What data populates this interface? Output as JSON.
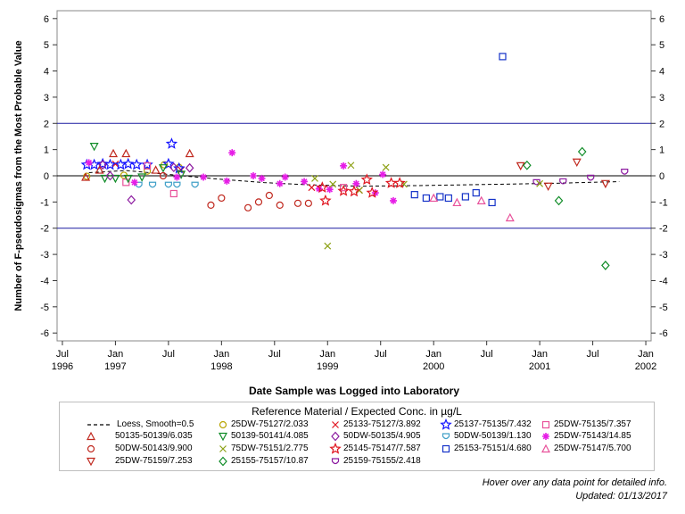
{
  "chart_data": {
    "type": "scatter",
    "xlabel": "Date Sample was Logged into Laboratory",
    "ylabel": "Number of F-pseudosigmas from the Most Probable Value",
    "xlim": [
      1996.45,
      2002.05
    ],
    "ylim": [
      -6.3,
      6.3
    ],
    "x_ticks": [
      {
        "x": 1996.5,
        "label": "Jul",
        "sub": "1996"
      },
      {
        "x": 1997.0,
        "label": "Jan",
        "sub": "1997"
      },
      {
        "x": 1997.5,
        "label": "Jul",
        "sub": ""
      },
      {
        "x": 1998.0,
        "label": "Jan",
        "sub": "1998"
      },
      {
        "x": 1998.5,
        "label": "Jul",
        "sub": ""
      },
      {
        "x": 1999.0,
        "label": "Jan",
        "sub": "1999"
      },
      {
        "x": 1999.5,
        "label": "Jul",
        "sub": ""
      },
      {
        "x": 2000.0,
        "label": "Jan",
        "sub": "2000"
      },
      {
        "x": 2000.5,
        "label": "Jul",
        "sub": ""
      },
      {
        "x": 2001.0,
        "label": "Jan",
        "sub": "2001"
      },
      {
        "x": 2001.5,
        "label": "Jul",
        "sub": ""
      },
      {
        "x": 2002.0,
        "label": "Jan",
        "sub": "2002"
      }
    ],
    "y_ticks": [
      6,
      5,
      4,
      3,
      2,
      1,
      0,
      -1,
      -2,
      -3,
      -4,
      -5,
      -6
    ],
    "reference_lines": {
      "solid_black": [
        0
      ],
      "solid_blue": [
        2,
        -2
      ]
    },
    "legend_title": "Reference Material / Expected Conc. in µg/L",
    "legend_placement": "bottom",
    "series": [
      {
        "name": "Loess, Smooth=0.5",
        "marker": "dash",
        "color": "#000000",
        "points": [
          [
            1996.75,
            0.12
          ],
          [
            1997.1,
            0.2
          ],
          [
            1997.5,
            0.05
          ],
          [
            1997.95,
            -0.12
          ],
          [
            1998.4,
            -0.26
          ],
          [
            1998.8,
            -0.34
          ],
          [
            1999.3,
            -0.4
          ],
          [
            1999.9,
            -0.37
          ],
          [
            2000.5,
            -0.33
          ],
          [
            2001.1,
            -0.29
          ],
          [
            2001.75,
            -0.22
          ]
        ]
      },
      {
        "name": "25DW-75127/2.033",
        "marker": "circle",
        "color": "#b8a400",
        "points": [
          [
            1996.73,
            -0.02
          ],
          [
            1997.08,
            0.02
          ],
          [
            1997.3,
            0.18
          ],
          [
            1997.46,
            0.42
          ],
          [
            1997.6,
            0.32
          ]
        ]
      },
      {
        "name": "25133-75127/3.892",
        "marker": "x",
        "color": "#e0141e",
        "points": [
          [
            1997.0,
            0.45
          ],
          [
            1997.62,
            0.22
          ],
          [
            1998.85,
            -0.45
          ],
          [
            1999.3,
            -0.55
          ]
        ]
      },
      {
        "name": "25137-75135/7.432",
        "marker": "star",
        "color": "#1414ff",
        "points": [
          [
            1996.73,
            0.42
          ],
          [
            1996.8,
            0.42
          ],
          [
            1996.88,
            0.45
          ],
          [
            1996.95,
            0.42
          ],
          [
            1997.05,
            0.42
          ],
          [
            1997.12,
            0.45
          ],
          [
            1997.2,
            0.42
          ],
          [
            1997.3,
            0.42
          ],
          [
            1997.5,
            0.45
          ],
          [
            1997.53,
            1.22
          ],
          [
            1997.6,
            0.28
          ]
        ]
      },
      {
        "name": "25DW-75135/7.357",
        "marker": "square",
        "color": "#e8509a",
        "points": [
          [
            1997.1,
            -0.25
          ],
          [
            1997.3,
            0.38
          ],
          [
            1997.55,
            -0.68
          ],
          [
            1999.15,
            -0.45
          ]
        ]
      },
      {
        "name": "50135-50139/6.035",
        "marker": "triangle",
        "color": "#c0281e",
        "points": [
          [
            1996.72,
            -0.05
          ],
          [
            1996.85,
            0.22
          ],
          [
            1996.98,
            0.85
          ],
          [
            1997.1,
            0.85
          ],
          [
            1997.38,
            0.22
          ],
          [
            1997.7,
            0.85
          ]
        ]
      },
      {
        "name": "50139-50141/4.085",
        "marker": "triangle-down",
        "color": "#108c28",
        "points": [
          [
            1996.8,
            1.12
          ],
          [
            1996.9,
            -0.1
          ],
          [
            1997.0,
            -0.1
          ],
          [
            1997.12,
            -0.1
          ],
          [
            1997.25,
            -0.05
          ],
          [
            1997.45,
            0.3
          ],
          [
            1997.62,
            0.05
          ]
        ]
      },
      {
        "name": "50DW-50135/4.905",
        "marker": "diamond",
        "color": "#8c1aa0",
        "points": [
          [
            1996.88,
            0.42
          ],
          [
            1996.95,
            0.0
          ],
          [
            1997.15,
            -0.92
          ],
          [
            1997.55,
            0.32
          ],
          [
            1997.7,
            0.3
          ]
        ]
      },
      {
        "name": "50DW-50139/1.130",
        "marker": "shield",
        "color": "#40a0c8",
        "points": [
          [
            1997.22,
            -0.35
          ],
          [
            1997.35,
            -0.35
          ],
          [
            1997.5,
            -0.35
          ],
          [
            1997.58,
            -0.35
          ],
          [
            1997.75,
            -0.35
          ]
        ]
      },
      {
        "name": "25DW-75143/14.85",
        "marker": "asterisk",
        "color": "#e61ee6",
        "points": [
          [
            1996.75,
            0.5
          ],
          [
            1997.18,
            -0.25
          ],
          [
            1997.58,
            -0.05
          ],
          [
            1997.83,
            -0.05
          ],
          [
            1998.05,
            -0.2
          ],
          [
            1998.1,
            0.88
          ],
          [
            1998.3,
            0.0
          ],
          [
            1998.38,
            -0.1
          ],
          [
            1998.55,
            -0.3
          ],
          [
            1998.6,
            -0.05
          ],
          [
            1998.78,
            -0.22
          ],
          [
            1998.92,
            -0.5
          ],
          [
            1999.02,
            -0.52
          ],
          [
            1999.15,
            0.38
          ],
          [
            1999.27,
            -0.3
          ],
          [
            1999.45,
            -0.65
          ],
          [
            1999.52,
            0.05
          ],
          [
            1999.62,
            -0.95
          ]
        ]
      },
      {
        "name": "50DW-50143/9.900",
        "marker": "circle",
        "color": "#c0281e",
        "points": [
          [
            1997.45,
            0.0
          ],
          [
            1997.9,
            -1.12
          ],
          [
            1998.0,
            -0.85
          ],
          [
            1998.25,
            -1.22
          ],
          [
            1998.35,
            -1.0
          ],
          [
            1998.45,
            -0.75
          ],
          [
            1998.55,
            -1.12
          ],
          [
            1998.72,
            -1.05
          ],
          [
            1998.82,
            -1.05
          ]
        ]
      },
      {
        "name": "75DW-75151/2.775",
        "marker": "x",
        "color": "#8ca014",
        "points": [
          [
            1998.88,
            -0.1
          ],
          [
            1999.0,
            -2.68
          ],
          [
            1999.05,
            -0.32
          ],
          [
            1999.22,
            0.4
          ],
          [
            1999.3,
            -0.55
          ],
          [
            1999.55,
            0.32
          ],
          [
            1999.72,
            -0.32
          ]
        ]
      },
      {
        "name": "25145-75147/7.587",
        "marker": "star",
        "color": "#e0141e",
        "points": [
          [
            1998.95,
            -0.45
          ],
          [
            1998.98,
            -0.95
          ],
          [
            1999.15,
            -0.58
          ],
          [
            1999.25,
            -0.6
          ],
          [
            1999.37,
            -0.15
          ],
          [
            1999.42,
            -0.65
          ],
          [
            1999.6,
            -0.28
          ],
          [
            1999.68,
            -0.28
          ]
        ]
      },
      {
        "name": "25DW-75143/14.85",
        "marker": "asterisk",
        "color": "#e61ee6",
        "points": []
      },
      {
        "name": "50DW-50143/9.900",
        "marker": "circle",
        "color": "#c0281e",
        "points": []
      },
      {
        "name": "25153-75151/4.680",
        "marker": "square",
        "color": "#1432c8",
        "points": []
      },
      {
        "name": "25DW-75147/5.700",
        "marker": "triangle",
        "color": "#e8509a",
        "points": []
      },
      {
        "name": "25159-75155/2.418",
        "marker": "pentagon",
        "color": "#8c1aa0",
        "points": []
      }
    ],
    "extra_points": {
      "blue_squares": [
        [
          1999.82,
          -0.72
        ],
        [
          1999.93,
          -0.85
        ],
        [
          2000.06,
          -0.8
        ],
        [
          2000.14,
          -0.85
        ],
        [
          2000.3,
          -0.8
        ],
        [
          2000.4,
          -0.65
        ],
        [
          2000.55,
          -1.02
        ],
        [
          2000.65,
          4.55
        ]
      ],
      "pink_triangles": [
        [
          2000.0,
          -0.85
        ],
        [
          2000.22,
          -1.02
        ],
        [
          2000.45,
          -0.95
        ],
        [
          2000.72,
          -1.6
        ]
      ],
      "red_tri_down": [
        [
          2000.82,
          0.38
        ],
        [
          2001.08,
          -0.4
        ],
        [
          2001.35,
          0.52
        ],
        [
          2001.62,
          -0.3
        ]
      ],
      "green_diamonds": [
        [
          2000.88,
          0.4
        ],
        [
          2001.18,
          -0.95
        ],
        [
          2001.4,
          0.92
        ],
        [
          2001.62,
          -3.42
        ]
      ],
      "purple_shields": [
        [
          2000.97,
          -0.25
        ],
        [
          2001.22,
          -0.22
        ],
        [
          2001.48,
          -0.08
        ],
        [
          2001.8,
          0.15
        ]
      ],
      "olive_x": [
        [
          2001.0,
          -0.3
        ]
      ]
    }
  },
  "legend_items": [
    {
      "label": "Loess, Smooth=0.5",
      "marker": "dash",
      "color": "#000000"
    },
    {
      "label": "25DW-75127/2.033",
      "marker": "circle",
      "color": "#b8a400"
    },
    {
      "label": "25133-75127/3.892",
      "marker": "x",
      "color": "#e0141e"
    },
    {
      "label": "25137-75135/7.432",
      "marker": "star",
      "color": "#1414ff"
    },
    {
      "label": "25DW-75135/7.357",
      "marker": "square",
      "color": "#e8509a"
    },
    {
      "label": "50135-50139/6.035",
      "marker": "triangle",
      "color": "#c0281e"
    },
    {
      "label": "50139-50141/4.085",
      "marker": "triangle-down",
      "color": "#108c28"
    },
    {
      "label": "50DW-50135/4.905",
      "marker": "diamond",
      "color": "#8c1aa0"
    },
    {
      "label": "50DW-50139/1.130",
      "marker": "shield",
      "color": "#40a0c8"
    },
    {
      "label": "25DW-75143/14.85",
      "marker": "asterisk",
      "color": "#e61ee6"
    },
    {
      "label": "50DW-50143/9.900",
      "marker": "circle",
      "color": "#c0281e"
    },
    {
      "label": "75DW-75151/2.775",
      "marker": "x",
      "color": "#8ca014"
    },
    {
      "label": "25145-75147/7.587",
      "marker": "star",
      "color": "#e0141e"
    },
    {
      "label": "25153-75151/4.680",
      "marker": "square",
      "color": "#1432c8"
    },
    {
      "label": "25DW-75147/5.700",
      "marker": "triangle",
      "color": "#e8509a"
    },
    {
      "label": "25DW-75159/7.253",
      "marker": "triangle-down",
      "color": "#c0281e"
    },
    {
      "label": "25155-75157/10.87",
      "marker": "diamond",
      "color": "#108c28"
    },
    {
      "label": "25159-75155/2.418",
      "marker": "shield",
      "color": "#8c1aa0"
    }
  ],
  "footnote": {
    "hover": "Hover over any data point for detailed info.",
    "updated": "Updated: 01/13/2017"
  }
}
